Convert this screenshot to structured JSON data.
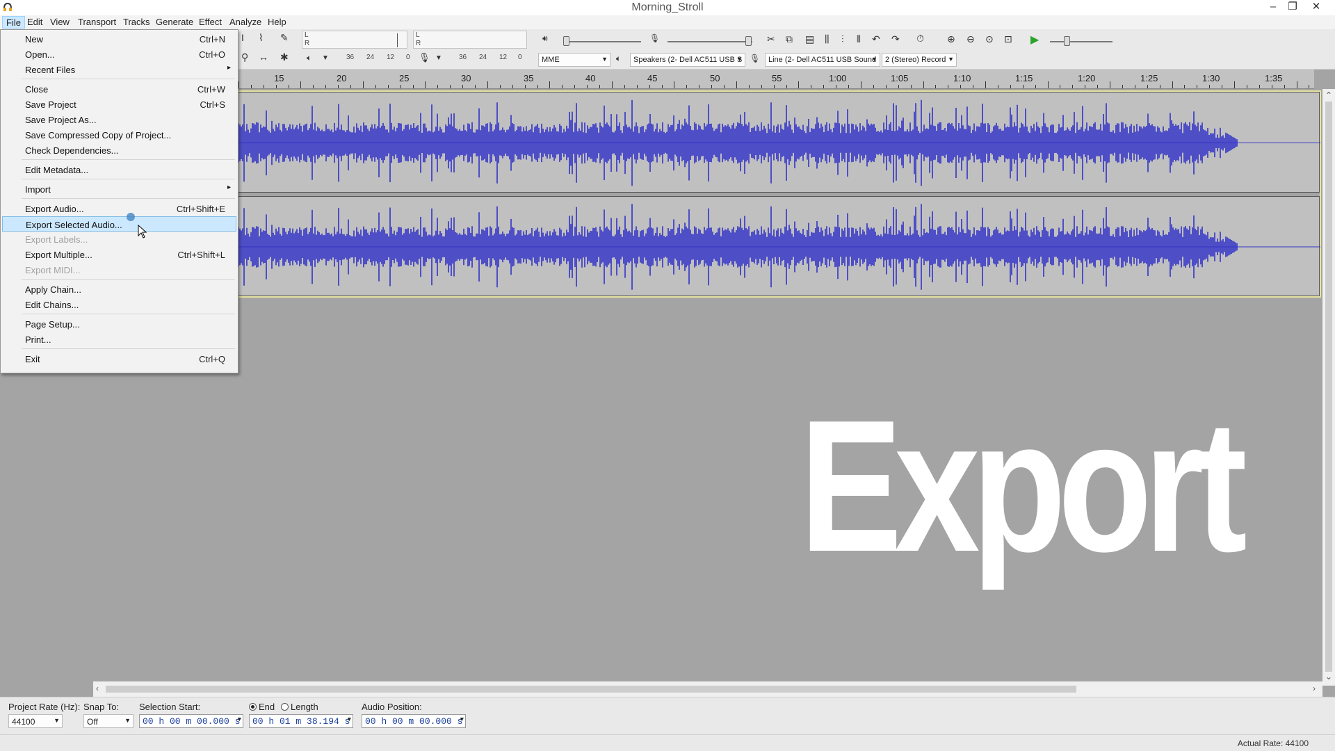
{
  "window": {
    "title": "Morning_Stroll",
    "controls": {
      "minimize": "–",
      "restore": "❐",
      "close": "✕"
    }
  },
  "menubar": {
    "items": [
      "File",
      "Edit",
      "View",
      "Transport",
      "Tracks",
      "Generate",
      "Effect",
      "Analyze",
      "Help"
    ],
    "active": "File"
  },
  "toolbar": {
    "record_meter_scale": [
      "36",
      "24",
      "12",
      "0"
    ],
    "play_meter_scale": [
      "36",
      "24",
      "12",
      "0"
    ],
    "meter_channels": [
      "L",
      "R",
      "L",
      "R"
    ],
    "host": "MME",
    "output_device": "Speakers (2- Dell AC511 USB S",
    "input_device": "Line (2- Dell AC511 USB Sound",
    "channels": "2 (Stereo) Record"
  },
  "ruler": {
    "labels": [
      "15",
      "20",
      "25",
      "30",
      "35",
      "40",
      "45",
      "50",
      "55",
      "1:00",
      "1:05",
      "1:10",
      "1:15",
      "1:20",
      "1:25",
      "1:30",
      "1:35"
    ]
  },
  "file_menu": {
    "items": [
      {
        "label": "New",
        "shortcut": "Ctrl+N"
      },
      {
        "label": "Open...",
        "shortcut": "Ctrl+O"
      },
      {
        "label": "Recent Files",
        "submenu": true
      },
      {
        "separator": true
      },
      {
        "label": "Close",
        "shortcut": "Ctrl+W"
      },
      {
        "label": "Save Project",
        "shortcut": "Ctrl+S"
      },
      {
        "label": "Save Project As..."
      },
      {
        "label": "Save Compressed Copy of Project..."
      },
      {
        "label": "Check Dependencies..."
      },
      {
        "separator": true
      },
      {
        "label": "Edit Metadata..."
      },
      {
        "separator": true
      },
      {
        "label": "Import",
        "submenu": true
      },
      {
        "separator": true
      },
      {
        "label": "Export Audio...",
        "shortcut": "Ctrl+Shift+E"
      },
      {
        "label": "Export Selected Audio...",
        "highlighted": true
      },
      {
        "label": "Export Labels...",
        "disabled": true
      },
      {
        "label": "Export Multiple...",
        "shortcut": "Ctrl+Shift+L"
      },
      {
        "label": "Export MIDI...",
        "disabled": true
      },
      {
        "separator": true
      },
      {
        "label": "Apply Chain..."
      },
      {
        "label": "Edit Chains..."
      },
      {
        "separator": true
      },
      {
        "label": "Page Setup..."
      },
      {
        "label": "Print..."
      },
      {
        "separator": true
      },
      {
        "label": "Exit",
        "shortcut": "Ctrl+Q"
      }
    ]
  },
  "overlay": {
    "text": "Export"
  },
  "selection_toolbar": {
    "project_rate_label": "Project Rate (Hz):",
    "project_rate_value": "44100",
    "snap_to_label": "Snap To:",
    "snap_to_value": "Off",
    "selection_start_label": "Selection Start:",
    "end_label": "End",
    "length_label": "Length",
    "audio_position_label": "Audio Position:",
    "selection_start": "00 h 00 m 00.000 s",
    "selection_end": "00 h 01 m 38.194 s",
    "audio_position": "00 h 00 m 00.000 s"
  },
  "status": {
    "actual_rate": "Actual Rate: 44100"
  },
  "colors": {
    "waveform": "#3232c8",
    "menu_highlight": "#cce8ff",
    "track_bg": "#c0c0c0",
    "time_text": "#1b3fa0"
  }
}
